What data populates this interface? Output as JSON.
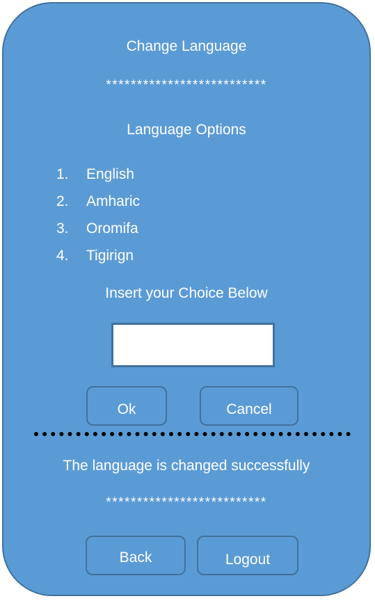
{
  "screen": {
    "title": "Change Language",
    "separator_top": "**************************",
    "options_title": "Language Options",
    "options": [
      {
        "number": "1.",
        "label": "English"
      },
      {
        "number": "2.",
        "label": "Amharic"
      },
      {
        "number": "3.",
        "label": "Oromifa"
      },
      {
        "number": "4.",
        "label": "Tigirign"
      }
    ],
    "instruction": "Insert your Choice Below",
    "choice_input": {
      "value": "",
      "placeholder": ""
    },
    "ok_label": "Ok",
    "cancel_label": "Cancel",
    "status_message": "The language is changed successfully",
    "separator_bottom": "**************************",
    "back_label": "Back",
    "logout_label": "Logout"
  },
  "colors": {
    "background": "#5b9bd5",
    "border": "#41719c",
    "text": "#ffffff",
    "divider": "#000000"
  }
}
